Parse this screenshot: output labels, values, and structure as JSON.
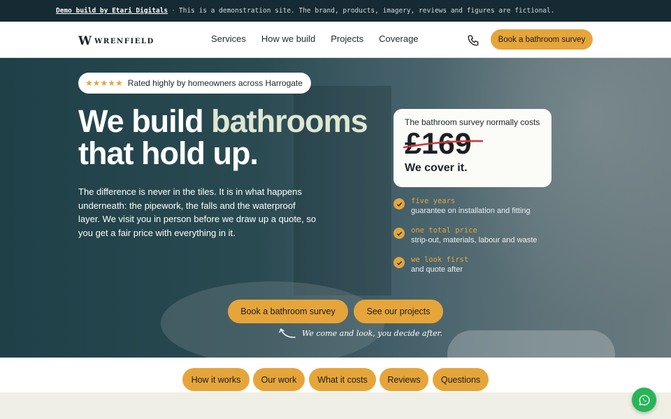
{
  "demo_bar": {
    "link": "Demo build by Etari Digitals",
    "separator": "·",
    "notice": "This is a demonstration site. The brand, products, imagery, reviews and figures are fictional."
  },
  "nav": {
    "logo_mark": "W",
    "logo_word": "WRENFIELD",
    "links": [
      "Services",
      "How we build",
      "Projects",
      "Coverage"
    ],
    "phone_icon": "phone-icon",
    "cta": "Book a bathroom survey"
  },
  "hero": {
    "rating": {
      "stars": "★★★★★",
      "text": "Rated highly by homeowners across Harrogate"
    },
    "headline_line1_a": "We build ",
    "headline_line1_b": "bathrooms",
    "headline_line2": "that hold up.",
    "intro": "The difference is never in the tiles. It is in what happens underneath: the pipework, the falls and the waterproof layer. We visit you in person before we draw up a quote, so you get a fair price with everything in it.",
    "price_card": {
      "top": "The bathroom survey normally costs",
      "price": "£169",
      "cover": "We cover it."
    },
    "benefits": [
      {
        "title": "five years",
        "desc": "guarantee on installation and fitting"
      },
      {
        "title": "one total price",
        "desc": "strip-out, materials, labour and waste"
      },
      {
        "title": "we look first",
        "desc": "and quote after"
      }
    ],
    "buttons": {
      "primary": "Book a bathroom survey",
      "secondary": "See our projects"
    },
    "note": "We come and look, you decide after."
  },
  "subnav": [
    "How it works",
    "Our work",
    "What it costs",
    "Reviews",
    "Questions"
  ],
  "colors": {
    "accent": "#e6a53a",
    "dark": "#152a33",
    "whatsapp": "#27b557"
  }
}
